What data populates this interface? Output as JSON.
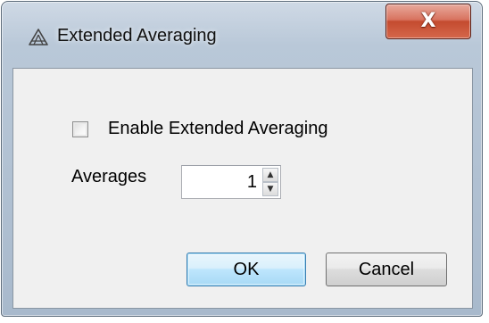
{
  "window": {
    "title": "Extended Averaging",
    "app_icon": "triangle-knot-icon",
    "close_icon": "close-icon",
    "close_glyph": "X"
  },
  "form": {
    "enable_label": "Enable Extended Averaging",
    "enable_checked": false,
    "averages_label": "Averages",
    "averages_value": "1",
    "spin_up_glyph": "▲",
    "spin_down_glyph": "▼"
  },
  "buttons": {
    "ok_label": "OK",
    "cancel_label": "Cancel"
  },
  "colors": {
    "ok_accent": "#3c7fb1",
    "close_red": "#c44b2f"
  }
}
